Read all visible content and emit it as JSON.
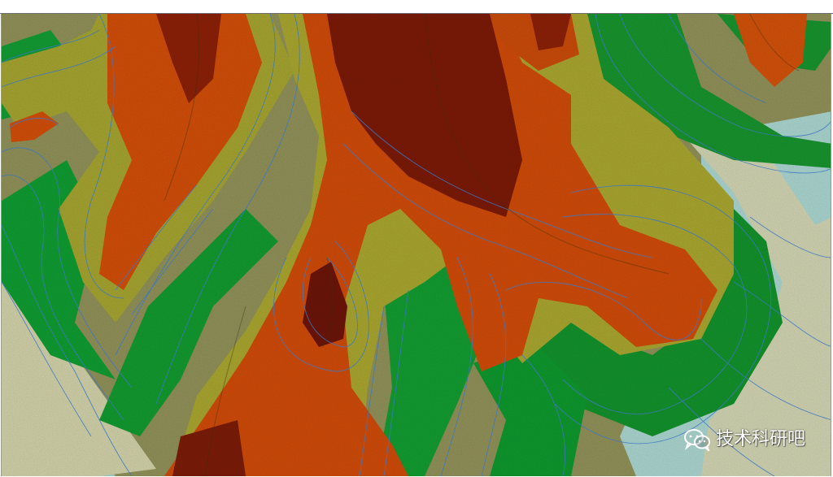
{
  "watermark": {
    "text": "技术科研吧",
    "icon": "wechat-icon"
  },
  "map": {
    "type": "hillshaded-elevation-tin-with-contours",
    "colors": {
      "lowest": "#9ad0cc",
      "low": "#d8dcb2",
      "lower-mid": "#0f9b2f",
      "mid": "#9f9f2d",
      "upper-mid": "#c94a08",
      "highest": "#6a1206",
      "contour": "#3f7fd0"
    }
  }
}
